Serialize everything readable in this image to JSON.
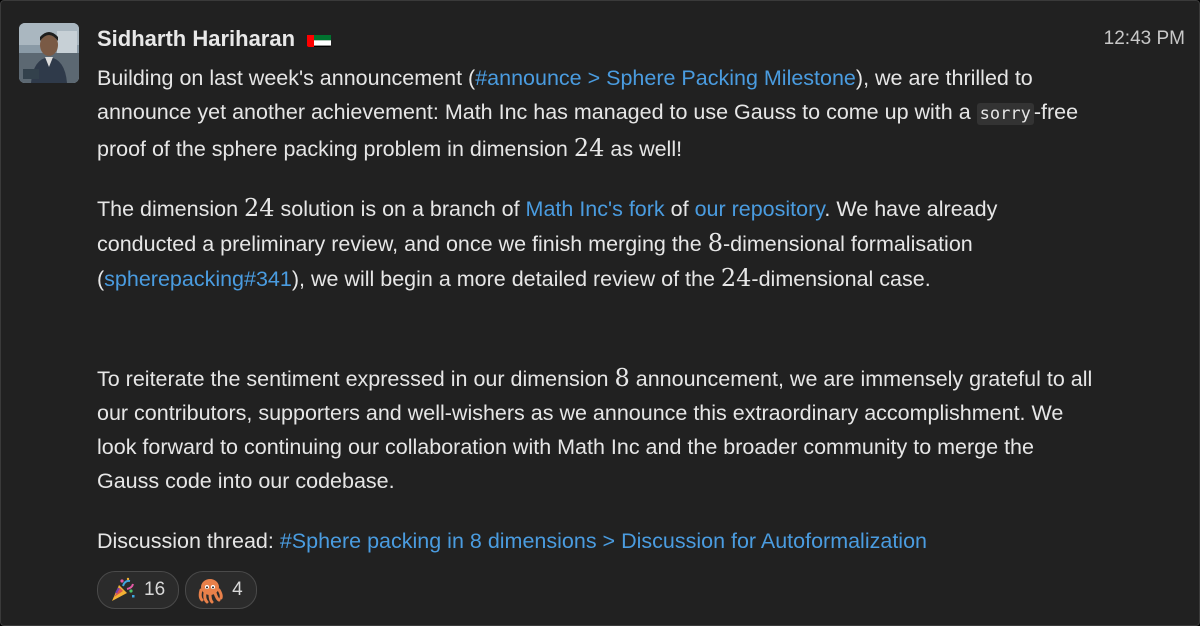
{
  "message": {
    "sender": "Sidharth Hariharan",
    "sender_flag_icon": "uae-flag-icon",
    "timestamp": "12:43 PM",
    "p1": {
      "t1": "Building on last week's announcement (",
      "link1": "#announce > Sphere Packing Milestone",
      "t2": "), we are thrilled to announce yet another achievement: Math Inc has managed to use Gauss to come up with a ",
      "code": "sorry",
      "t3": "-free proof of the sphere packing problem in dimension ",
      "math": "24",
      "t4": " as well!"
    },
    "p2": {
      "t1": "The dimension ",
      "math1": "24",
      "t2": " solution is on a branch of ",
      "link1": "Math Inc's fork",
      "t3": " of ",
      "link2": "our repository",
      "t4": ". We have already conducted a preliminary review, and once we finish merging the ",
      "math2": "8",
      "t5": "-dimensional formalisation (",
      "link3": "spherepacking#341",
      "t6": "), we will begin a more detailed review of the ",
      "math3": "24",
      "t7": "-dimensional case."
    },
    "p3": {
      "t1": "To reiterate the sentiment expressed in our dimension ",
      "math": "8",
      "t2": " announcement, we are immensely grateful to all our contributors, supporters and well-wishers as we announce this extraordinary accomplishment. We look forward to continuing our collaboration with Math Inc and the broader community to merge the Gauss code into our codebase."
    },
    "p4": {
      "t1": "Discussion thread: ",
      "link1": "#Sphere packing in 8 dimensions > Discussion for Autoformalization"
    }
  },
  "reactions": [
    {
      "icon": "party-popper-icon",
      "count": "16"
    },
    {
      "icon": "octopus-icon",
      "count": "4"
    }
  ],
  "colors": {
    "background": "#212121",
    "link": "#4a9ce0",
    "text": "#e6e6e6",
    "flag_green": "#00732f",
    "flag_red": "#ff0000"
  }
}
